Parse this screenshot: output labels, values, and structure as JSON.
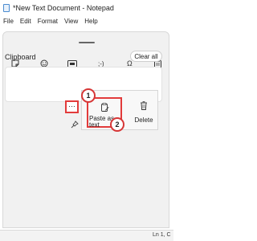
{
  "window": {
    "title": "*New Text Document - Notepad"
  },
  "menu": {
    "items": [
      "File",
      "Edit",
      "Format",
      "View",
      "Help"
    ]
  },
  "panel": {
    "tabs": [
      {
        "name": "sticker-icon",
        "glyph": "🗒"
      },
      {
        "name": "emoji-icon",
        "glyph": "☺"
      },
      {
        "name": "gif-icon",
        "glyph": "GIF"
      },
      {
        "name": "kaomoji-icon",
        "glyph": ";-)"
      },
      {
        "name": "symbols-icon",
        "glyph": "Ω"
      },
      {
        "name": "clipboard-icon",
        "glyph": "📋"
      }
    ],
    "active_tab": "clipboard-icon",
    "section_label": "Clipboard",
    "clear_all_label": "Clear all"
  },
  "card_menu": {
    "more_label": "…",
    "paste_label": "Paste as text",
    "delete_label": "Delete"
  },
  "annotations": {
    "badge1": "1",
    "badge2": "2"
  },
  "status": {
    "position": "Ln 1, C"
  },
  "colors": {
    "highlight": "#e23b3b",
    "active_tab": "#2a6ad8"
  }
}
